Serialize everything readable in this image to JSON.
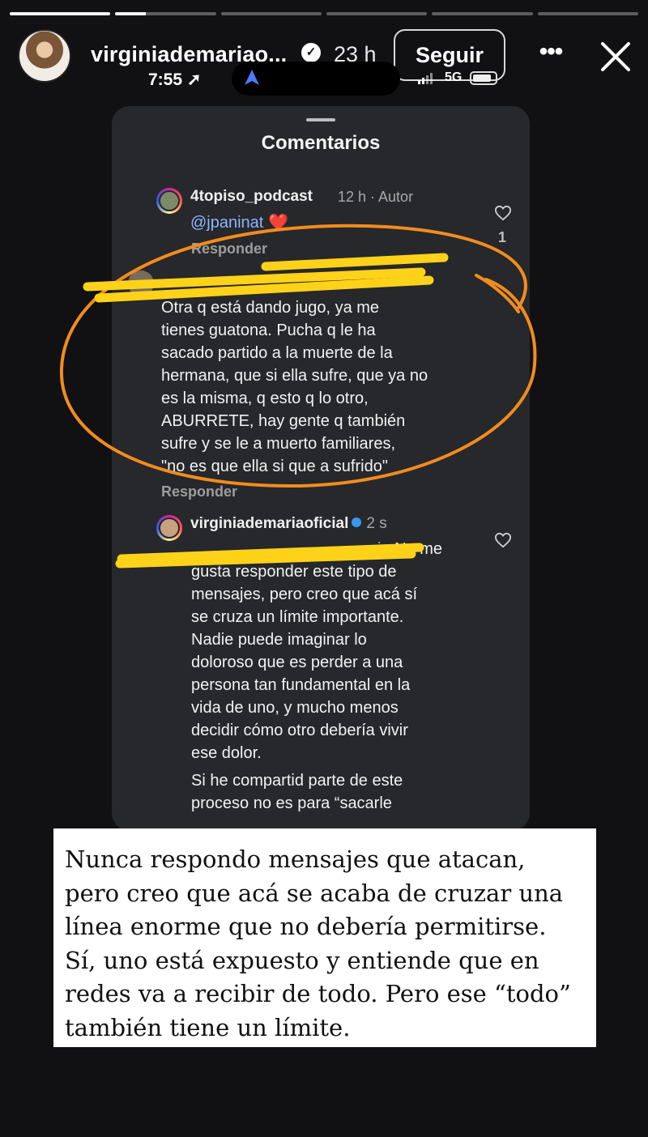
{
  "story": {
    "progress_segments": [
      1,
      0.3,
      0,
      0,
      0,
      0
    ],
    "username": "virginiademariao...",
    "time_ago": "23 h",
    "follow_label": "Seguir",
    "more_label": "•••",
    "close_icon": "close-icon"
  },
  "status_bar": {
    "time": "7:55",
    "network": "5G",
    "battery_level": 0.85
  },
  "comments_panel": {
    "title": "Comentarios",
    "comments": [
      {
        "user": "4topiso_podcast",
        "meta": "12 h · Autor",
        "mention": "@jpaninat",
        "emoji": "❤️",
        "reply_label": "Responder",
        "likes": "1"
      },
      {
        "text_lines": [
          "Otra q está dando jugo, ya me",
          "tienes guatona. Pucha q le ha",
          "sacado partido a la muerte de la",
          "hermana, que si ella sufre, que ya no",
          "es la misma, q esto q lo otro,",
          "ABURRETE, hay gente q también",
          "sufre y se le a muerto familiares,",
          "\"no es que ella si que a sufrido\""
        ],
        "reply_label": "Responder"
      },
      {
        "user": "virginiademariaoficial",
        "meta": "2 s",
        "mention_tail": "ia",
        "text_lines": [
          "No me",
          "gusta responder este tipo de",
          "mensajes, pero creo que acá sí",
          "se cruza un límite importante.",
          "Nadie puede imaginar lo",
          "doloroso que es perder a una",
          "persona tan fundamental en la",
          "vida de uno, y mucho menos",
          "decidir cómo otro debería vivir",
          "ese dolor."
        ],
        "text_lines_2": [
          "Si he compartid  parte de este",
          "proceso no es para “sacarle"
        ]
      }
    ]
  },
  "caption": {
    "lines": [
      "Nunca respondo mensajes que atacan,",
      "pero creo que acá se acaba de cruzar una",
      "línea enorme que no debería permitirse.",
      "Sí, uno está expuesto y entiende que en",
      "redes va a recibir  de todo. Pero ese “todo”",
      "también tiene un límite."
    ]
  },
  "colors": {
    "circle_orange": "#f28c1e",
    "highlighter_yellow": "#ffd21a",
    "mention_blue": "#8fb3ff"
  }
}
